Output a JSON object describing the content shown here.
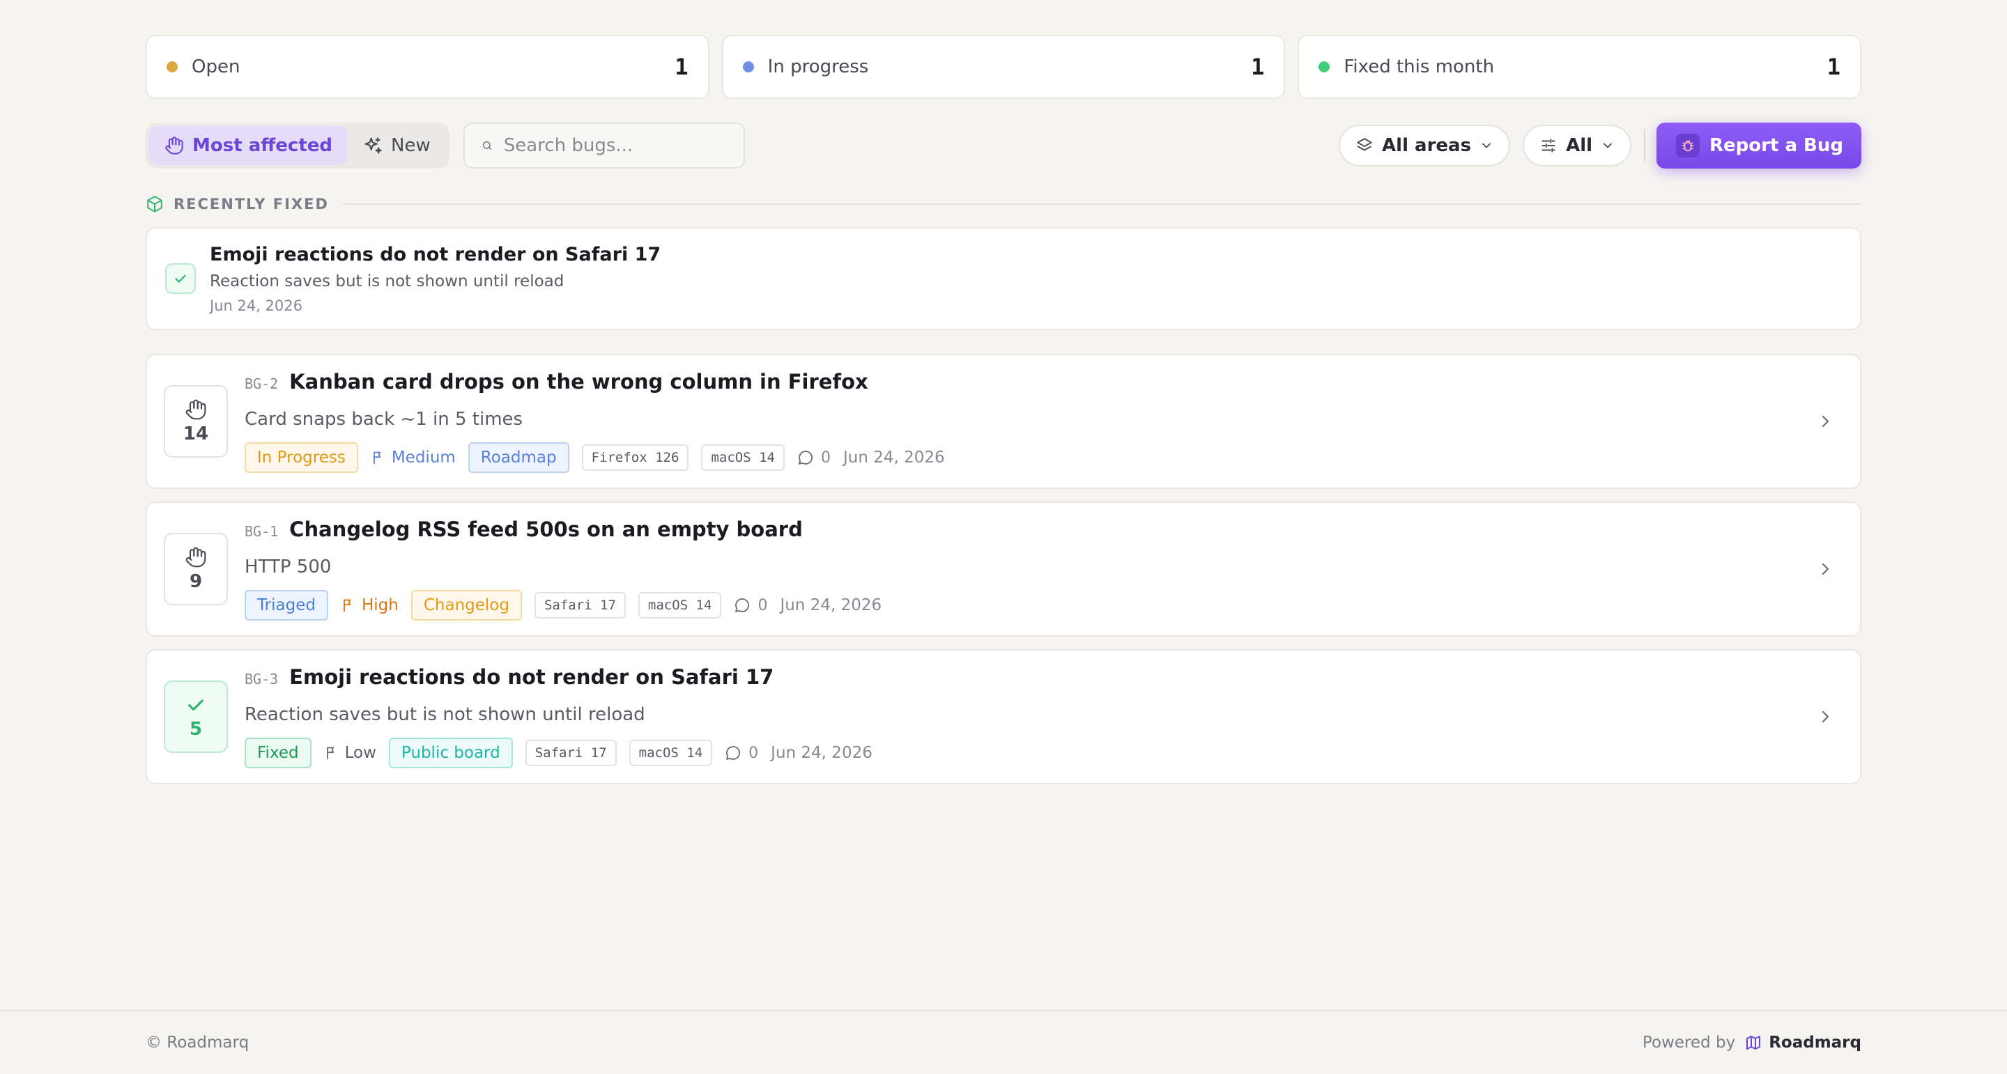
{
  "stats": [
    {
      "label": "Open",
      "value": "1",
      "color": "#d9a93e"
    },
    {
      "label": "In progress",
      "value": "1",
      "color": "#6f8fe6"
    },
    {
      "label": "Fixed this month",
      "value": "1",
      "color": "#3fcf78"
    }
  ],
  "toolbar": {
    "sort_most_affected": "Most affected",
    "sort_new": "New",
    "search_placeholder": "Search bugs...",
    "area_filter": "All areas",
    "status_filter": "All",
    "report_button": "Report a Bug"
  },
  "recently_fixed": {
    "heading": "RECENTLY FIXED",
    "item": {
      "title": "Emoji reactions do not render on Safari 17",
      "subtitle": "Reaction saves but is not shown until reload",
      "date": "Jun 24, 2026"
    }
  },
  "bugs": [
    {
      "votes": "14",
      "id": "BG-2",
      "title": "Kanban card drops on the wrong column in Firefox",
      "description": "Card snaps back ~1 in 5 times",
      "status": "In Progress",
      "priority": "Medium",
      "area": "Roadmap",
      "env": [
        "Firefox 126",
        "macOS 14"
      ],
      "comments": "0",
      "date": "Jun 24, 2026"
    },
    {
      "votes": "9",
      "id": "BG-1",
      "title": "Changelog RSS feed 500s on an empty board",
      "description": "HTTP 500",
      "status": "Triaged",
      "priority": "High",
      "area": "Changelog",
      "env": [
        "Safari 17",
        "macOS 14"
      ],
      "comments": "0",
      "date": "Jun 24, 2026"
    },
    {
      "votes": "5",
      "id": "BG-3",
      "title": "Emoji reactions do not render on Safari 17",
      "description": "Reaction saves but is not shown until reload",
      "status": "Fixed",
      "priority": "Low",
      "area": "Public board",
      "env": [
        "Safari 17",
        "macOS 14"
      ],
      "comments": "0",
      "date": "Jun 24, 2026"
    }
  ],
  "footer": {
    "copyright": "© Roadmarq",
    "powered_by": "Powered by",
    "brand": "Roadmarq"
  },
  "colors": {
    "accent": "#7a48ea",
    "in_progress": "#e8a020",
    "triaged": "#4a7fd9",
    "fixed": "#2fb56b"
  }
}
